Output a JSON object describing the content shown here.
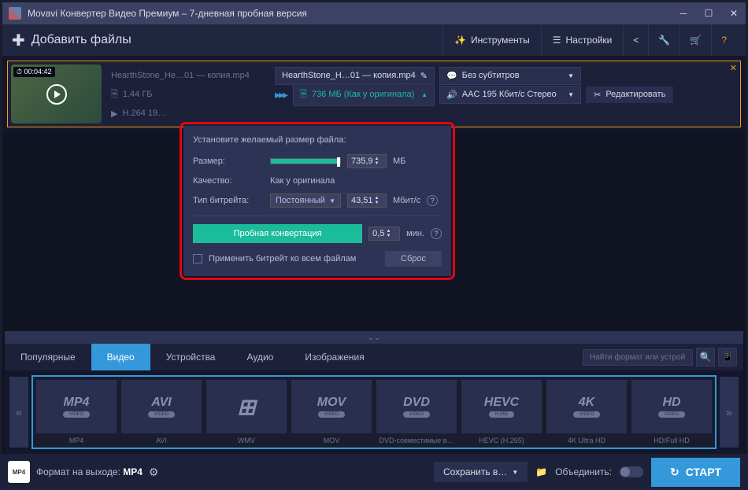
{
  "titlebar": {
    "text": "Movavi Конвертер Видео Премиум – 7-дневная пробная версия"
  },
  "menubar": {
    "add_files": "Добавить файлы",
    "tools": "Инструменты",
    "settings": "Настройки"
  },
  "file": {
    "name_left": "HearthStone_He…01 — копия.mp4",
    "name_mid": "HearthStone_H…01 — копия.mp4",
    "size_left": "1.44 ГБ",
    "size_mid": "736 МБ (Как у оригинала)",
    "codec_left": "H.264 19…",
    "subtitles": "Без субтитров",
    "audio": "AAC 195 Кбит/с Стерео",
    "edit": "Редактировать",
    "duration": "00:04:42"
  },
  "popup": {
    "title": "Установите желаемый размер файла:",
    "size_label": "Размер:",
    "size_value": "735,9",
    "size_unit": "МБ",
    "quality_label": "Качество:",
    "quality_value": "Как у оригинала",
    "bitrate_label": "Тип битрейта:",
    "bitrate_type": "Постоянный",
    "bitrate_value": "43,51",
    "bitrate_unit": "Мбит/с",
    "trial": "Пробная конвертация",
    "duration_value": "0,5",
    "duration_unit": "мин.",
    "apply_all": "Применить битрейт ко всем файлам",
    "reset": "Сброс"
  },
  "tabs": {
    "popular": "Популярные",
    "video": "Видео",
    "devices": "Устройства",
    "audio": "Аудио",
    "images": "Изображения",
    "search_placeholder": "Найти формат или устрой…"
  },
  "formats": [
    {
      "name": "MP4",
      "sub": "VIDEO",
      "label": "MP4"
    },
    {
      "name": "AVI",
      "sub": "VIDEO",
      "label": "AVI"
    },
    {
      "name": "⊞",
      "sub": "",
      "label": "WMV"
    },
    {
      "name": "MOV",
      "sub": "VIDEO",
      "label": "MOV"
    },
    {
      "name": "DVD",
      "sub": "VIDEO",
      "label": "DVD-совместимые в…"
    },
    {
      "name": "HEVC",
      "sub": "H.265",
      "label": "HEVC (H.265)"
    },
    {
      "name": "4K",
      "sub": "VIDEO",
      "label": "4K Ultra HD"
    },
    {
      "name": "HD",
      "sub": "VIDEO",
      "label": "HD/Full HD"
    }
  ],
  "footer": {
    "output_label": "Формат на выходе:",
    "output_value": "MP4",
    "save": "Сохранить в…",
    "merge": "Объединить:",
    "start": "СТАРТ"
  }
}
